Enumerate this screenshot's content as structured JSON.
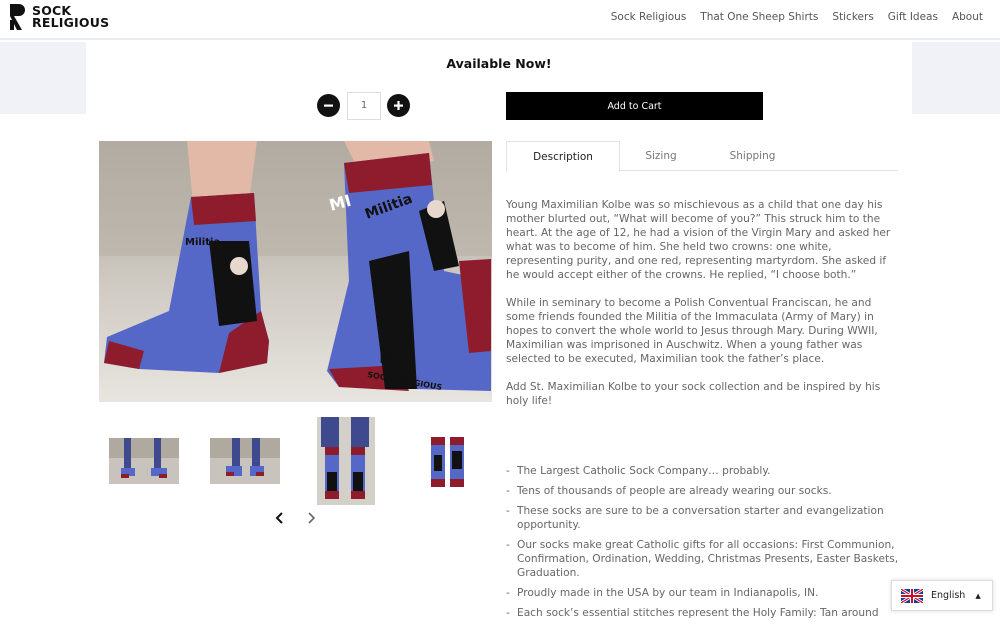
{
  "brand": {
    "line1": "SOCK",
    "line2": "RELIGIOUS"
  },
  "nav": [
    "Sock Religious",
    "That One Sheep Shirts",
    "Stickers",
    "Gift Ideas",
    "About"
  ],
  "product": {
    "availability": "Available Now!",
    "quantity": "1",
    "add_to_cart": "Add to Cart"
  },
  "tabs": [
    "Description",
    "Sizing",
    "Shipping"
  ],
  "active_tab": "Description",
  "description": [
    "Young Maximilian Kolbe was so mischievous as a child that one day his mother blurted out, “What will become of you?” This struck him to the heart. At the age of 12, he had a vision of the Virgin Mary and asked her what was to become of him. She held two crowns: one white, representing purity, and one red, representing martyrdom. She asked if he would accept either of the crowns. He replied, “I choose both.”",
    "While in seminary to become a Polish Conventual Franciscan, he and some friends founded the Militia of the Immaculata (Army of Mary) in hopes to convert the whole world to Jesus through Mary. During WWII, Maximilian was imprisoned in Auschwitz. When a young father was selected to be executed, Maximilian took the father’s place.",
    "Add St. Maximilian Kolbe to your sock collection and be inspired by his holy life!"
  ],
  "bullets": [
    "The Largest Catholic Sock Company… probably.",
    "Tens of thousands of people are already wearing our socks.",
    "These socks are sure to be a conversation starter and evangelization opportunity.",
    "Our socks make great Catholic gifts for all occasions: First Communion, Confirmation, Ordination, Wedding, Christmas Presents, Easter Baskets, Graduation.",
    "Proudly made in the USA by our team in Indianapolis, IN.",
    "Each sock’s essential stitches represent the Holy Family: Tan around"
  ],
  "sock_text": {
    "militia": "Militia",
    "mi": "MI",
    "brand": "SOCK RELIGIOUS",
    "r": "R"
  },
  "language": {
    "label": "English",
    "flag": "uk-flag-icon"
  },
  "icons": {
    "minus": "minus-icon",
    "plus": "plus-icon",
    "prev": "chevron-left-icon",
    "next": "chevron-right-icon",
    "caret": "caret-up-icon"
  },
  "colors": {
    "sock_red": "#8e1c2c",
    "sock_blue": "#5568c8",
    "black": "#000000",
    "band": "#f1f2f8"
  }
}
